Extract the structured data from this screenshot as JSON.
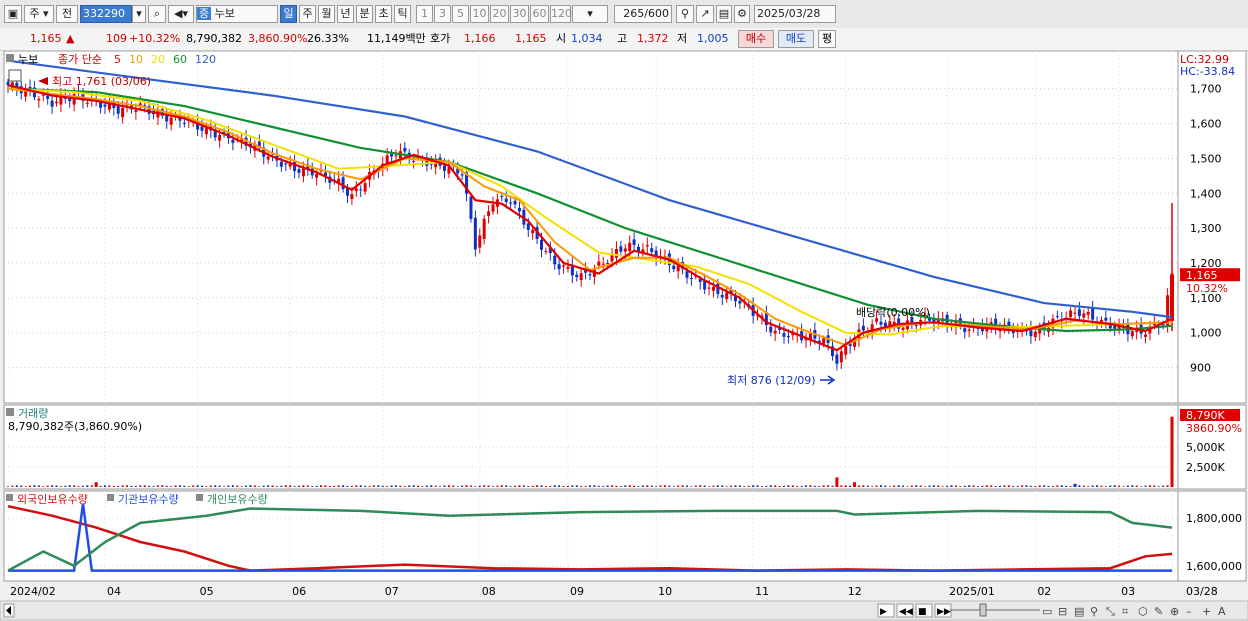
{
  "toolbar": {
    "period_select": "주",
    "prev_label": "전",
    "code": "332290",
    "stock_name": "누보",
    "periods": [
      "일",
      "주",
      "월",
      "년",
      "분",
      "초",
      "틱"
    ],
    "intervals": [
      "1",
      "3",
      "5",
      "10",
      "20",
      "30",
      "60",
      "120"
    ],
    "count": "265",
    "count_max": "/600",
    "date": "2025/03/28"
  },
  "quote": {
    "price": "1,165",
    "change_arrow": "▲",
    "change": "109",
    "change_pct": "+10.32%",
    "volume": "8,790,382",
    "volume_pct": "3,860.90%",
    "turnover_pct": "26.33%",
    "amount": "11,149백만",
    "bid_label": "호가",
    "ask": "1,166",
    "bid": "1,165",
    "open_label": "시",
    "open": "1,034",
    "high_label": "고",
    "high": "1,372",
    "low_label": "저",
    "low": "1,005",
    "buy_label": "매수",
    "sell_label": "매도",
    "eval_label": "평"
  },
  "price_panel": {
    "name": "누보",
    "ma_label": "종가 단순",
    "ma_periods": [
      "5",
      "10",
      "20",
      "60",
      "120"
    ],
    "high_note": "최고 1,761 (03/06)",
    "low_note": "최저 876 (12/09)",
    "dividend_note": "배당락(0.00%)",
    "lc": "LC:32.99",
    "hc": "HC:-33.84",
    "last_price": "1,165",
    "last_pct": "10.32%"
  },
  "volume_panel": {
    "title": "거래량",
    "summary": "8,790,382주(3,860.90%)",
    "last": "8,790K",
    "last_pct": "3860.90%"
  },
  "holdings_panel": {
    "legends": [
      "외국인보유수량",
      "기관보유수량",
      "개인보유수량"
    ]
  },
  "colors": {
    "ma5": "#e00000",
    "ma10": "#ff9900",
    "ma20": "#f5e000",
    "ma60": "#109030",
    "ma120": "#3060d0",
    "up": "#e00000",
    "down": "#1030c0",
    "foreign": "#d01010",
    "institution": "#2050e0",
    "individual": "#2e8b57"
  },
  "chart_data": {
    "type": "line",
    "x_axis_labels": [
      "2024/02",
      "04",
      "05",
      "06",
      "07",
      "08",
      "09",
      "10",
      "11",
      "12",
      "2025/01",
      "02",
      "03",
      "03/28"
    ],
    "price": {
      "y_ticks": [
        900,
        1000,
        1100,
        1200,
        1300,
        1400,
        1500,
        1600,
        1700
      ],
      "ylim": [
        810,
        1785
      ],
      "close_points": [
        [
          0,
          1710
        ],
        [
          5,
          1690
        ],
        [
          10,
          1660
        ],
        [
          15,
          1680
        ],
        [
          20,
          1660
        ],
        [
          25,
          1640
        ],
        [
          30,
          1650
        ],
        [
          35,
          1620
        ],
        [
          40,
          1610
        ],
        [
          45,
          1580
        ],
        [
          50,
          1560
        ],
        [
          55,
          1540
        ],
        [
          60,
          1500
        ],
        [
          65,
          1470
        ],
        [
          70,
          1460
        ],
        [
          75,
          1430
        ],
        [
          78,
          1390
        ],
        [
          82,
          1450
        ],
        [
          88,
          1520
        ],
        [
          92,
          1500
        ],
        [
          98,
          1480
        ],
        [
          103,
          1460
        ],
        [
          106,
          1250
        ],
        [
          110,
          1380
        ],
        [
          114,
          1380
        ],
        [
          118,
          1300
        ],
        [
          124,
          1200
        ],
        [
          130,
          1160
        ],
        [
          135,
          1200
        ],
        [
          140,
          1250
        ],
        [
          145,
          1240
        ],
        [
          150,
          1200
        ],
        [
          155,
          1160
        ],
        [
          160,
          1120
        ],
        [
          165,
          1100
        ],
        [
          170,
          1050
        ],
        [
          174,
          1000
        ],
        [
          180,
          990
        ],
        [
          185,
          980
        ],
        [
          188,
          920
        ],
        [
          192,
          990
        ],
        [
          197,
          1030
        ],
        [
          203,
          1020
        ],
        [
          208,
          1040
        ],
        [
          213,
          1030
        ],
        [
          218,
          1010
        ],
        [
          223,
          1020
        ],
        [
          228,
          1010
        ],
        [
          233,
          1000
        ],
        [
          238,
          1040
        ],
        [
          243,
          1060
        ],
        [
          248,
          1030
        ],
        [
          253,
          1010
        ],
        [
          257,
          1000
        ],
        [
          262,
          1030
        ],
        [
          264,
          1165
        ]
      ],
      "ma_lines": [
        {
          "name": "5",
          "values": [
            [
              0,
              1710
            ],
            [
              10,
              1680
            ],
            [
              20,
              1665
            ],
            [
              30,
              1640
            ],
            [
              40,
              1615
            ],
            [
              50,
              1565
            ],
            [
              60,
              1505
            ],
            [
              70,
              1460
            ],
            [
              78,
              1410
            ],
            [
              85,
              1480
            ],
            [
              92,
              1510
            ],
            [
              100,
              1480
            ],
            [
              106,
              1380
            ],
            [
              112,
              1370
            ],
            [
              118,
              1320
            ],
            [
              126,
              1200
            ],
            [
              134,
              1170
            ],
            [
              142,
              1235
            ],
            [
              150,
              1210
            ],
            [
              158,
              1150
            ],
            [
              166,
              1100
            ],
            [
              172,
              1030
            ],
            [
              180,
              990
            ],
            [
              188,
              950
            ],
            [
              194,
              1000
            ],
            [
              202,
              1025
            ],
            [
              210,
              1030
            ],
            [
              220,
              1015
            ],
            [
              230,
              1005
            ],
            [
              240,
              1040
            ],
            [
              250,
              1025
            ],
            [
              258,
              1005
            ],
            [
              264,
              1040
            ]
          ]
        },
        {
          "name": "10",
          "values": [
            [
              0,
              1700
            ],
            [
              10,
              1685
            ],
            [
              20,
              1670
            ],
            [
              30,
              1650
            ],
            [
              40,
              1620
            ],
            [
              50,
              1575
            ],
            [
              60,
              1515
            ],
            [
              70,
              1470
            ],
            [
              80,
              1440
            ],
            [
              90,
              1500
            ],
            [
              100,
              1490
            ],
            [
              108,
              1420
            ],
            [
              116,
              1380
            ],
            [
              124,
              1260
            ],
            [
              132,
              1180
            ],
            [
              142,
              1215
            ],
            [
              150,
              1215
            ],
            [
              158,
              1165
            ],
            [
              166,
              1110
            ],
            [
              174,
              1040
            ],
            [
              182,
              1000
            ],
            [
              190,
              965
            ],
            [
              198,
              1010
            ],
            [
              208,
              1030
            ],
            [
              220,
              1020
            ],
            [
              232,
              1010
            ],
            [
              242,
              1035
            ],
            [
              252,
              1025
            ],
            [
              264,
              1030
            ]
          ]
        },
        {
          "name": "20",
          "values": [
            [
              0,
              1700
            ],
            [
              15,
              1690
            ],
            [
              30,
              1665
            ],
            [
              45,
              1610
            ],
            [
              60,
              1540
            ],
            [
              75,
              1470
            ],
            [
              88,
              1480
            ],
            [
              100,
              1490
            ],
            [
              112,
              1420
            ],
            [
              122,
              1330
            ],
            [
              134,
              1230
            ],
            [
              145,
              1210
            ],
            [
              156,
              1190
            ],
            [
              168,
              1140
            ],
            [
              180,
              1060
            ],
            [
              190,
              1000
            ],
            [
              200,
              995
            ],
            [
              212,
              1020
            ],
            [
              225,
              1015
            ],
            [
              240,
              1020
            ],
            [
              252,
              1025
            ],
            [
              264,
              1030
            ]
          ]
        },
        {
          "name": "60",
          "values": [
            [
              0,
              1700
            ],
            [
              20,
              1690
            ],
            [
              40,
              1650
            ],
            [
              60,
              1590
            ],
            [
              80,
              1530
            ],
            [
              100,
              1490
            ],
            [
              120,
              1400
            ],
            [
              140,
              1300
            ],
            [
              160,
              1220
            ],
            [
              180,
              1140
            ],
            [
              195,
              1080
            ],
            [
              210,
              1040
            ],
            [
              225,
              1020
            ],
            [
              240,
              1005
            ],
            [
              255,
              1010
            ],
            [
              264,
              1020
            ]
          ]
        },
        {
          "name": "120",
          "values": [
            [
              0,
              1780
            ],
            [
              30,
              1730
            ],
            [
              60,
              1680
            ],
            [
              90,
              1620
            ],
            [
              120,
              1520
            ],
            [
              150,
              1380
            ],
            [
              180,
              1270
            ],
            [
              210,
              1160
            ],
            [
              235,
              1085
            ],
            [
              255,
              1060
            ],
            [
              264,
              1045
            ]
          ]
        }
      ]
    },
    "volume": {
      "y_ticks": [
        "2,500K",
        "5,000K"
      ],
      "ylim": [
        0,
        9000
      ],
      "spikes": [
        [
          20,
          600
        ],
        [
          188,
          1200
        ],
        [
          192,
          600
        ],
        [
          242,
          400
        ],
        [
          264,
          8790
        ]
      ]
    },
    "holdings": {
      "y_ticks": [
        "1,600,000",
        "1,800,000"
      ],
      "series": [
        {
          "name": "외국인보유수량",
          "values": [
            [
              0,
              1850000
            ],
            [
              10,
              1810000
            ],
            [
              20,
              1760000
            ],
            [
              30,
              1700000
            ],
            [
              40,
              1660000
            ],
            [
              50,
              1600000
            ],
            [
              55,
              1580000
            ],
            [
              70,
              1590000
            ],
            [
              90,
              1605000
            ],
            [
              110,
              1590000
            ],
            [
              130,
              1585000
            ],
            [
              150,
              1590000
            ],
            [
              170,
              1580000
            ],
            [
              190,
              1585000
            ],
            [
              210,
              1580000
            ],
            [
              230,
              1585000
            ],
            [
              250,
              1590000
            ],
            [
              258,
              1640000
            ],
            [
              264,
              1650000
            ]
          ]
        },
        {
          "name": "기관보유수량",
          "values": [
            [
              0,
              1580000
            ],
            [
              15,
              1580000
            ],
            [
              17,
              1860000
            ],
            [
              19,
              1580000
            ],
            [
              260,
              1580000
            ],
            [
              264,
              1580000
            ]
          ]
        },
        {
          "name": "개인보유수량",
          "values": [
            [
              0,
              1580000
            ],
            [
              8,
              1660000
            ],
            [
              15,
              1600000
            ],
            [
              22,
              1700000
            ],
            [
              30,
              1780000
            ],
            [
              45,
              1810000
            ],
            [
              55,
              1840000
            ],
            [
              80,
              1830000
            ],
            [
              100,
              1810000
            ],
            [
              130,
              1825000
            ],
            [
              160,
              1830000
            ],
            [
              188,
              1830000
            ],
            [
              192,
              1815000
            ],
            [
              220,
              1830000
            ],
            [
              250,
              1825000
            ],
            [
              255,
              1780000
            ],
            [
              264,
              1760000
            ]
          ]
        }
      ]
    }
  }
}
